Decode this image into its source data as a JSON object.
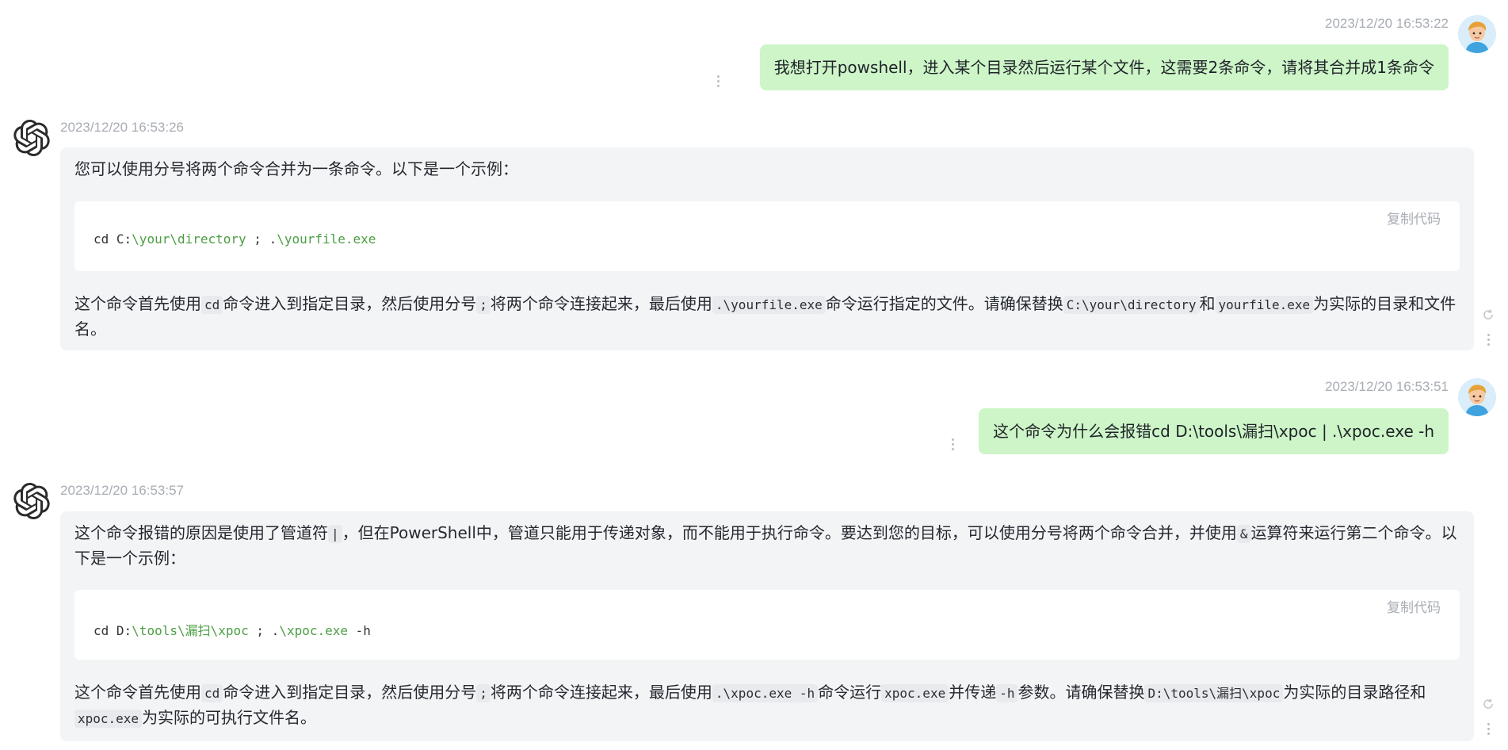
{
  "messages": [
    {
      "role": "user",
      "timestamp": "2023/12/20 16:53:22",
      "text": "我想打开powshell，进入某个目录然后运行某个文件，这需要2条命令，请将其合并成1条命令"
    },
    {
      "role": "assistant",
      "timestamp": "2023/12/20 16:53:26",
      "intro": "您可以使用分号将两个命令合并为一条命令。以下是一个示例：",
      "copy_label": "复制代码",
      "code": {
        "p1": "cd C:",
        "p2": "\\your\\directory",
        "p3": " ; .",
        "p4": "\\yourfile.exe",
        "p5": ""
      },
      "explain": {
        "t1": "这个命令首先使用",
        "c1": "cd",
        "t2": "命令进入到指定目录，然后使用分号",
        "c2": ";",
        "t3": "将两个命令连接起来，最后使用",
        "c3": ".\\yourfile.exe",
        "t4": "命令运行指定的文件。请确保替换",
        "c4": "C:\\your\\directory",
        "t5": "和",
        "c5": "yourfile.exe",
        "t6": "为实际的目录和文件名。"
      }
    },
    {
      "role": "user",
      "timestamp": "2023/12/20 16:53:51",
      "text": "这个命令为什么会报错cd D:\\tools\\漏扫\\xpoc | .\\xpoc.exe -h"
    },
    {
      "role": "assistant",
      "timestamp": "2023/12/20 16:53:57",
      "intro": {
        "t1": "这个命令报错的原因是使用了管道符",
        "c1": "|",
        "t2": "，但在PowerShell中，管道只能用于传递对象，而不能用于执行命令。要达到您的目标，可以使用分号将两个命令合并，并使用",
        "c2": "&",
        "t3": "运算符来运行第二个命令。以下是一个示例："
      },
      "copy_label": "复制代码",
      "code": {
        "p1": "cd D:",
        "p2": "\\tools\\漏扫\\xpoc",
        "p3": " ; .",
        "p4": "\\xpoc.exe",
        "p5": " -h"
      },
      "explain": {
        "t1": "这个命令首先使用",
        "c1": "cd",
        "t2": "命令进入到指定目录，然后使用分号",
        "c2": ";",
        "t3": "将两个命令连接起来，最后使用",
        "c3": ".\\xpoc.exe -h",
        "t4": "命令运行",
        "c4": "xpoc.exe",
        "t5": "并传递",
        "c5": "-h",
        "t6": "参数。请确保替换",
        "c6": "D:\\tools\\漏扫\\xpoc",
        "t7": "为实际的目录路径和",
        "c7": "xpoc.exe",
        "t8": "为实际的可执行文件名。"
      }
    }
  ],
  "icons": {
    "user_avatar": "user-avatar",
    "assistant_avatar": "openai-logo-icon",
    "more": "more-vertical-icon",
    "regenerate": "refresh-icon"
  },
  "colors": {
    "user_bubble": "#cdf5c8",
    "assistant_card": "#f3f4f6",
    "code_string": "#4b9e43",
    "timestamp": "#a8adb4"
  }
}
